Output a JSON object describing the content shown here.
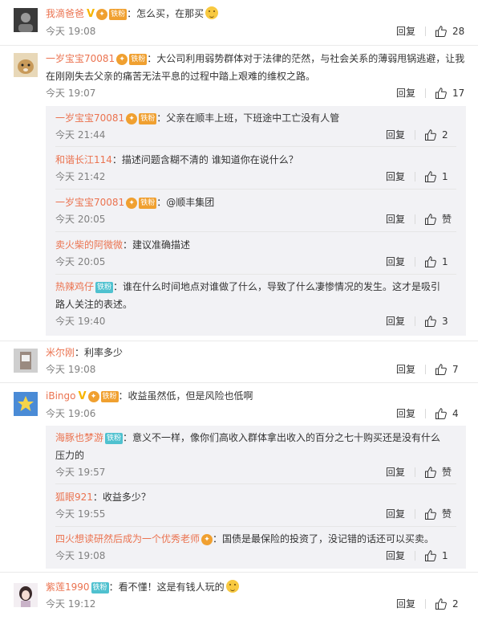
{
  "labels": {
    "reply": "回复",
    "zan": "赞"
  },
  "colors": {
    "username": "#eb7350",
    "meta": "#808080",
    "reply_bg": "#f2f2f5",
    "badge_orange": "#f0a030",
    "badge_teal": "#4fc1cf"
  },
  "comments": [
    {
      "user": "我滴爸爸",
      "text": "：怎么买，在那买",
      "time": "今天 19:08",
      "likes": "28",
      "avatar": "dark-avatar",
      "badge": "铁粉",
      "line2": ""
    },
    {
      "user": "一岁宝宝70081",
      "text": "：大公司利用弱势群体对于法律的茫然，与社会关系的薄弱甩锅逃避，让我",
      "line2": "在刚刚失去父亲的痛苦无法平息的过程中踏上艰难的维权之路。",
      "time": "今天 19:07",
      "likes": "17",
      "badge": "铁粉",
      "replies": [
        {
          "user": "一岁宝宝70081",
          "badge": "铁粉",
          "text": "：父亲在顺丰上班，下班途中工亡没有人管",
          "time": "今天 21:44",
          "likes": "2"
        },
        {
          "user": "和谐长江114",
          "text": "：描述问题含糊不清的 谁知道你在说什么？",
          "time": "今天 21:42",
          "likes": "1"
        },
        {
          "user": "一岁宝宝70081",
          "badge": "铁粉",
          "text": "：@顺丰集团",
          "time": "今天 20:05",
          "likes": "赞"
        },
        {
          "user": "卖火柴的阿微微",
          "text": "：建议准确描述",
          "time": "今天 20:05",
          "likes": "1"
        },
        {
          "user": "热辣鸡仔",
          "badge": "铁粉",
          "text": "：谁在什么时间地点对谁做了什么，导致了什么凄惨情况的发生。这才是吸引",
          "line2": "路人关注的表述。",
          "time": "今天 19:40",
          "likes": "3"
        }
      ]
    },
    {
      "user": "米尔刚",
      "text": "：利率多少",
      "time": "今天 19:08",
      "likes": "7"
    },
    {
      "user": "iBingo",
      "badge": "铁粉",
      "text": "：收益虽然低，但是风险也低啊",
      "time": "今天 19:06",
      "likes": "4",
      "replies": [
        {
          "user": "海豚也梦游",
          "badge": "铁粉",
          "text": "：意义不一样，像你们高收入群体拿出收入的百分之七十购买还是没有什么",
          "line2": "压力的",
          "time": "今天 19:57",
          "likes": "赞"
        },
        {
          "user": "狐眼921",
          "text": "：收益多少？",
          "time": "今天 19:55",
          "likes": "赞"
        },
        {
          "user": "四火想读研然后成为一个优秀老师",
          "text": "：国债是最保险的投资了，没记错的话还可以买卖。",
          "time": "今天 19:08",
          "likes": "1"
        }
      ]
    },
    {
      "user": "紫莲1990",
      "badge": "铁粉",
      "text": "：看不懂！这是有钱人玩的",
      "time": "今天 19:12",
      "likes": "2"
    }
  ]
}
